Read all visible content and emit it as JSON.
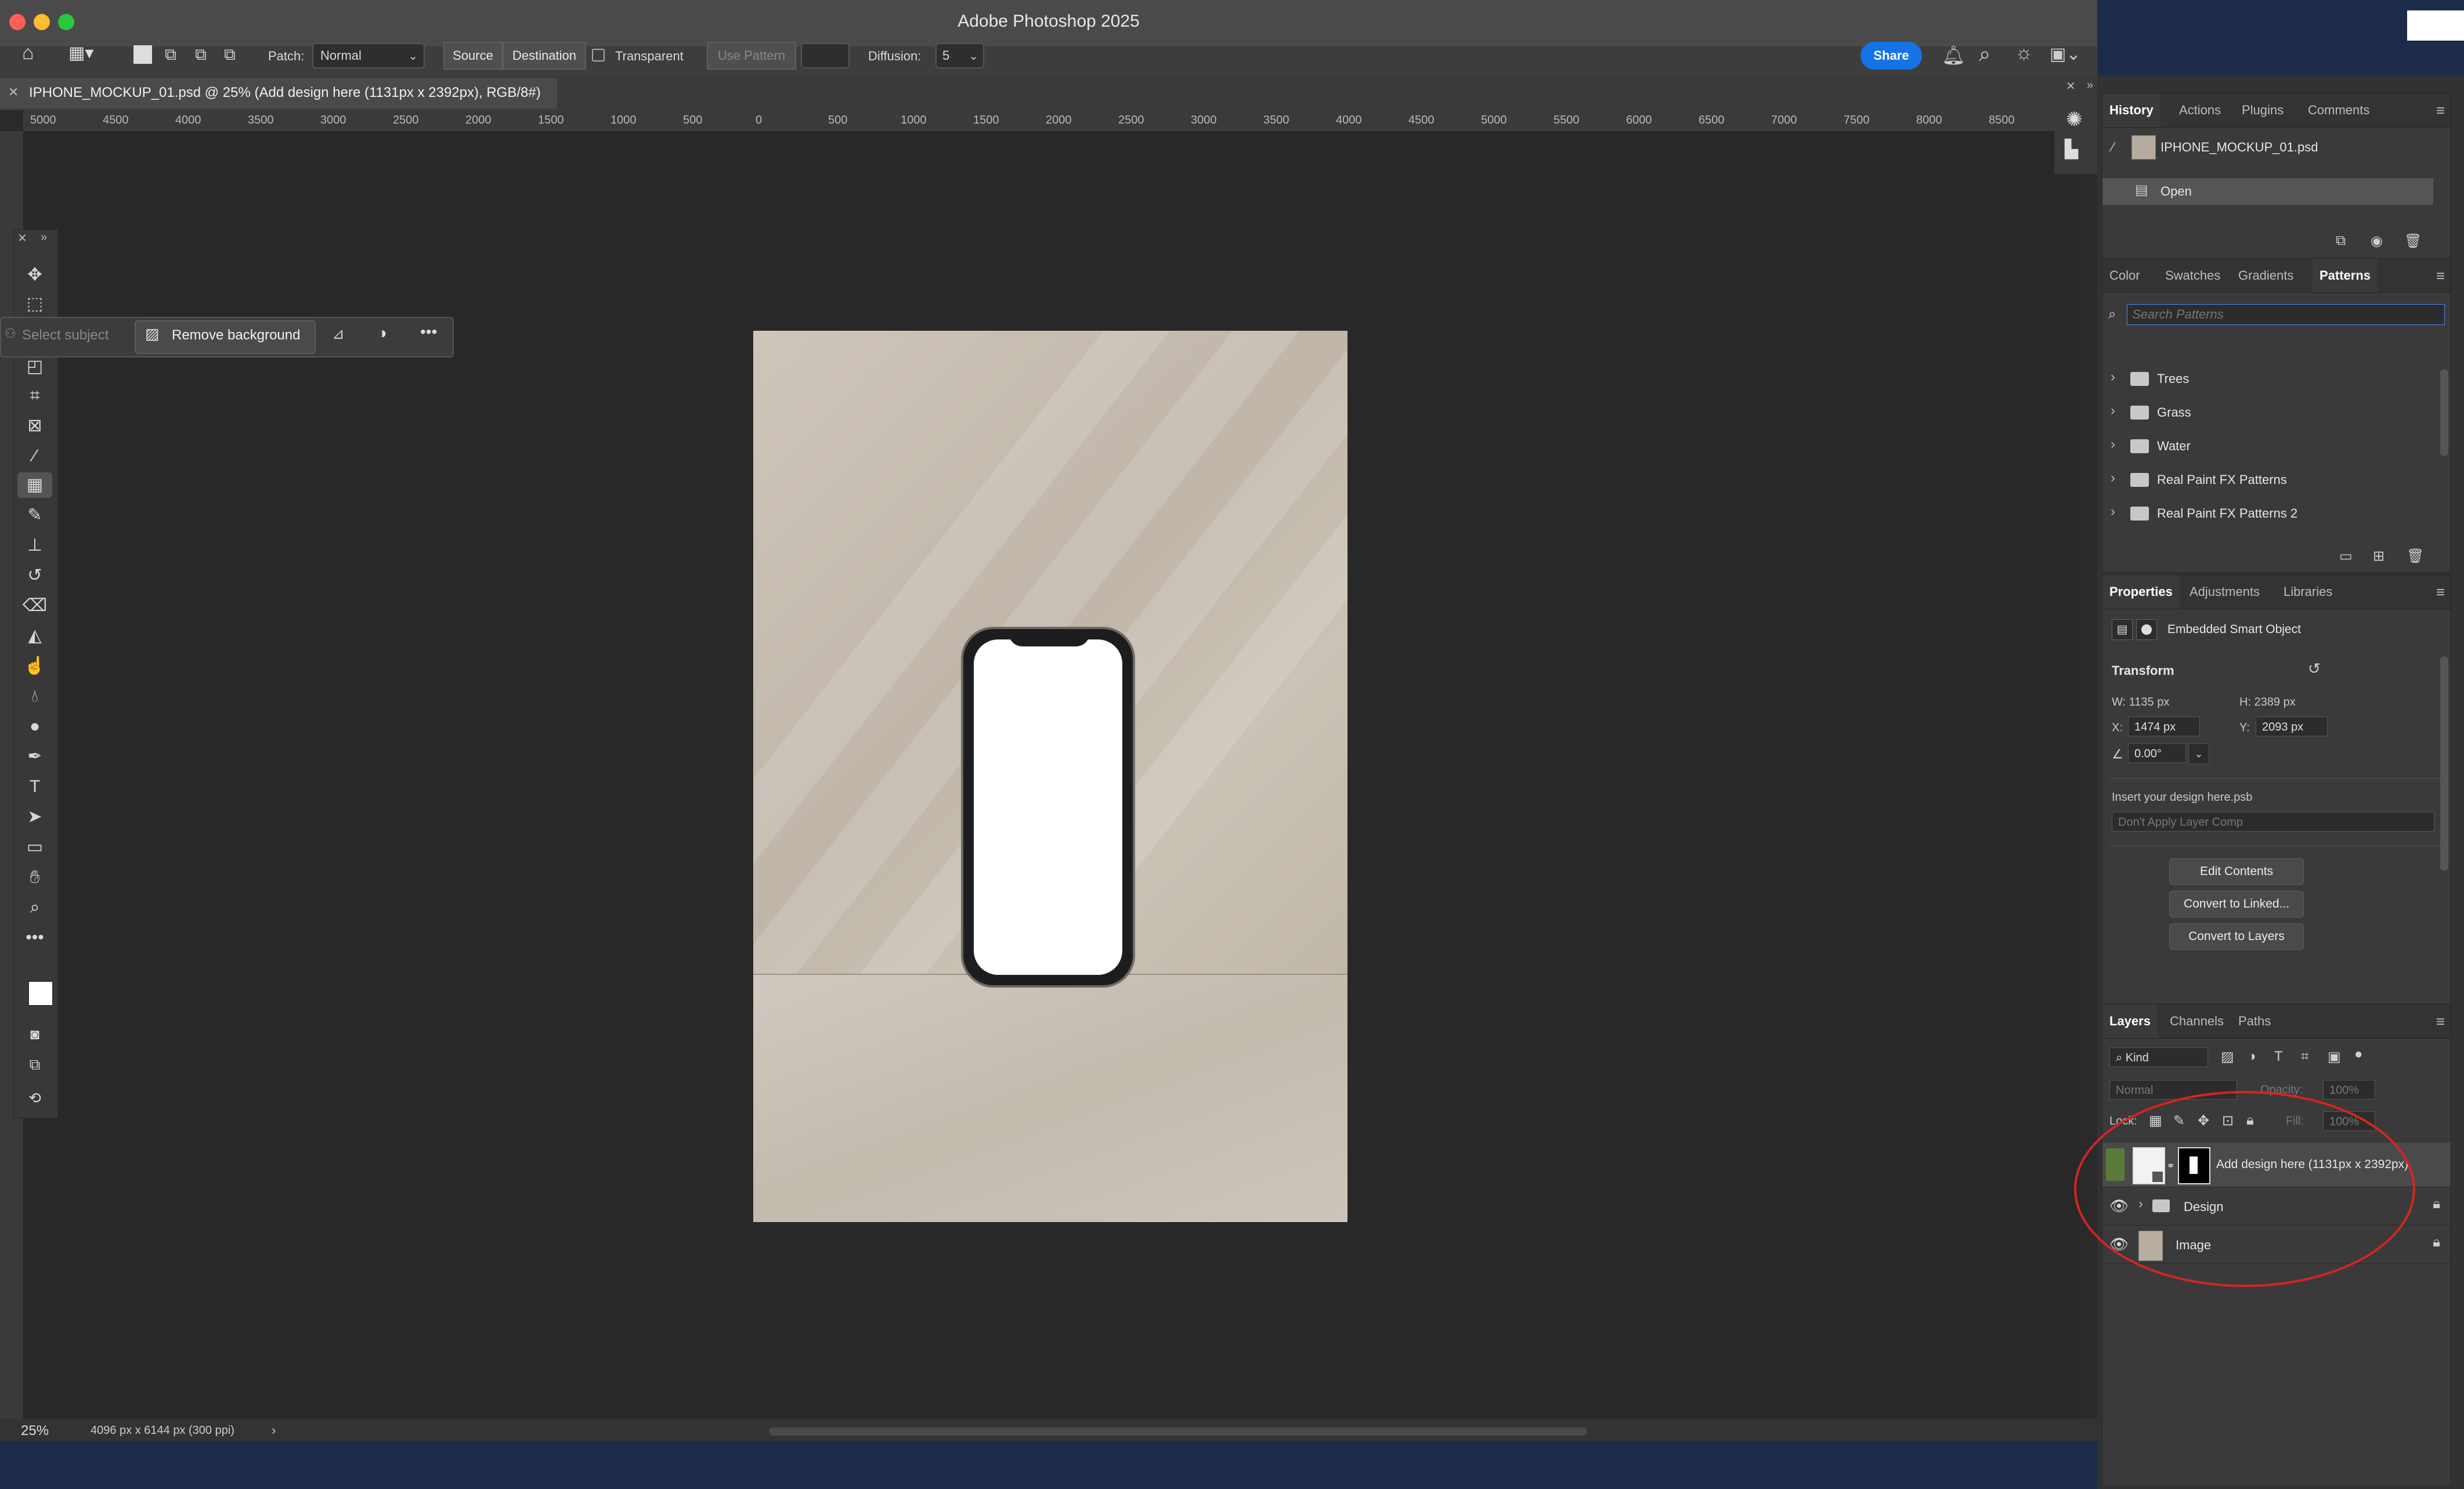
{
  "app_title": "Adobe Photoshop 2025",
  "options_bar": {
    "patch_label": "Patch:",
    "patch_value": "Normal",
    "source_label": "Source",
    "destination_label": "Destination",
    "transparent_label": "Transparent",
    "use_pattern_label": "Use Pattern",
    "diffusion_label": "Diffusion:",
    "diffusion_value": "5",
    "share_label": "Share"
  },
  "document_tab": {
    "label": "IPHONE_MOCKUP_01.psd @ 25% (Add design here (1131px x 2392px), RGB/8#)"
  },
  "ruler": {
    "ticks": [
      "5000",
      "4500",
      "4000",
      "3500",
      "3000",
      "2500",
      "2000",
      "1500",
      "1000",
      "500",
      "0",
      "500",
      "1000",
      "1500",
      "2000",
      "2500",
      "3000",
      "3500",
      "4000",
      "4500",
      "5000",
      "5500",
      "6000",
      "6500",
      "7000",
      "7500",
      "8000",
      "8500"
    ]
  },
  "taskbar": {
    "select_subject": "Select subject",
    "remove_background": "Remove background"
  },
  "status": {
    "zoom": "25%",
    "doc_info": "4096 px x 6144 px (300 ppi)"
  },
  "history_panel": {
    "tabs": [
      "History",
      "Actions",
      "Plugins",
      "Comments"
    ],
    "snapshot_name": "IPHONE_MOCKUP_01.psd",
    "step": "Open"
  },
  "patterns_panel": {
    "tabs": [
      "Color",
      "Swatches",
      "Gradients",
      "Patterns"
    ],
    "search_placeholder": "Search Patterns",
    "folders": [
      "Trees",
      "Grass",
      "Water",
      "Real Paint FX Patterns",
      "Real Paint FX Patterns 2"
    ]
  },
  "properties_panel": {
    "tabs": [
      "Properties",
      "Adjustments",
      "Libraries"
    ],
    "object_type": "Embedded Smart Object",
    "transform_label": "Transform",
    "w": "W:  1135 px",
    "h": "H:  2389 px",
    "x_label": "X:",
    "x_value": "1474 px",
    "y_label": "Y:",
    "y_value": "2093 px",
    "angle_value": "0.00°",
    "linked_file": "Insert your design here.psb",
    "layer_comp": "Don't Apply Layer Comp",
    "buttons": [
      "Edit Contents",
      "Convert to Linked...",
      "Convert to Layers"
    ]
  },
  "layers_panel": {
    "tabs": [
      "Layers",
      "Channels",
      "Paths"
    ],
    "filter_kind": "Kind",
    "blend_mode": "Normal",
    "opacity_label": "Opacity:",
    "opacity_value": "100%",
    "lock_label": "Lock:",
    "fill_label": "Fill:",
    "fill_value": "100%",
    "layers": [
      {
        "name": "Add design here (1131px x 2392px)"
      },
      {
        "name": "Design"
      },
      {
        "name": "Image"
      }
    ]
  },
  "colors": {
    "share_button": "#1473e6",
    "annotation": "#d4261f",
    "selected_layer": "#5b7a3a"
  }
}
